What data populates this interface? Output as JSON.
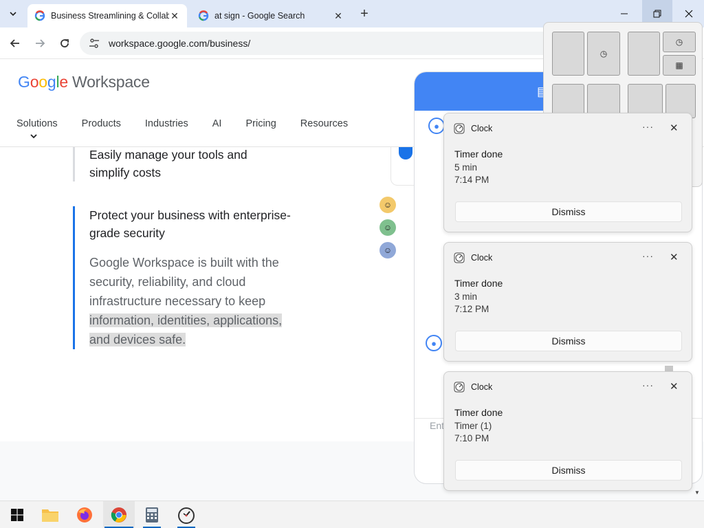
{
  "browser": {
    "tabs": [
      {
        "title": "Business Streamlining & Collab",
        "active": true
      },
      {
        "title": "at sign - Google Search",
        "active": false
      }
    ],
    "url": "workspace.google.com/business/"
  },
  "site": {
    "logo_google": [
      "G",
      "o",
      "o",
      "g",
      "l",
      "e"
    ],
    "logo_product": "Workspace",
    "nav": [
      "Solutions",
      "Products",
      "Industries",
      "AI",
      "Pricing",
      "Resources"
    ],
    "content": {
      "heading_1": "Easily manage your tools and simplify costs",
      "heading_2": "Protect your business with enterprise-grade security",
      "body_plain": "Google Workspace is built with the security, reliability, and cloud infrastructure necessary to keep ",
      "body_highlighted": "information, identities, applications, and devices safe."
    },
    "chat_input_placeholder": "Ent"
  },
  "notifications": [
    {
      "app": "Clock",
      "title": "Timer done",
      "line1": "5 min",
      "line2": "7:14 PM",
      "action": "Dismiss"
    },
    {
      "app": "Clock",
      "title": "Timer done",
      "line1": "3 min",
      "line2": "7:12 PM",
      "action": "Dismiss"
    },
    {
      "app": "Clock",
      "title": "Timer done",
      "line1": "Timer (1)",
      "line2": "7:10 PM",
      "action": "Dismiss"
    }
  ],
  "notification_more_glyph": "···",
  "taskbar": [
    "start-icon",
    "file-explorer-icon",
    "firefox-icon",
    "chrome-icon",
    "calculator-icon",
    "clock-app-icon"
  ],
  "colors": {
    "accent": "#1a73e8",
    "chat_header": "#4285f4",
    "taskbar_indicator": "#0067c0"
  }
}
